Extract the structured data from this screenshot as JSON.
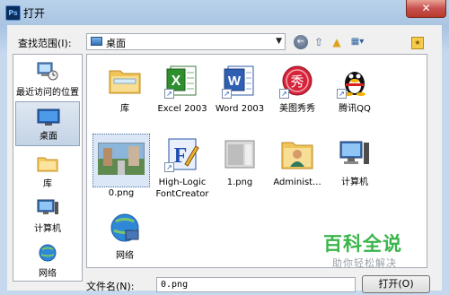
{
  "window": {
    "title": "打开",
    "app_icon": "Ps",
    "close_glyph": "✕"
  },
  "lookin": {
    "label": "查找范围(I):",
    "value": "桌面"
  },
  "toolbar": {
    "back": "←",
    "up": "⇧",
    "new_folder": "▲",
    "views": "▦▾",
    "extra": "★"
  },
  "places": [
    {
      "label": "最近访问的位置",
      "icon": "recent-places-icon"
    },
    {
      "label": "桌面",
      "icon": "desktop-icon",
      "selected": true
    },
    {
      "label": "库",
      "icon": "libraries-icon"
    },
    {
      "label": "计算机",
      "icon": "computer-icon"
    },
    {
      "label": "网络",
      "icon": "network-icon"
    }
  ],
  "files": [
    {
      "label": "库",
      "icon": "libraries-folder-icon"
    },
    {
      "label": "Excel 2003",
      "icon": "excel-icon",
      "shortcut": true
    },
    {
      "label": "Word 2003",
      "icon": "word-icon",
      "shortcut": true
    },
    {
      "label": "美图秀秀",
      "icon": "meitu-icon",
      "shortcut": true
    },
    {
      "label": "腾讯QQ",
      "icon": "qq-icon",
      "shortcut": true
    },
    {
      "label": "0.png",
      "icon": "image-thumbnail-icon",
      "selected": true
    },
    {
      "label": "High-Logic FontCreator",
      "icon": "fontcreator-icon",
      "shortcut": true
    },
    {
      "label": "1.png",
      "icon": "image-file-icon"
    },
    {
      "label": "Administ...",
      "icon": "user-folder-icon"
    },
    {
      "label": "计算机",
      "icon": "computer-icon"
    },
    {
      "label": "网络",
      "icon": "network-icon"
    }
  ],
  "filename": {
    "label": "文件名(N):",
    "value": "0.png"
  },
  "open_button": {
    "label": "打开(O)"
  },
  "watermark": {
    "brand": "百科全说",
    "tagline": "助你轻松解决"
  },
  "colors": {
    "accent": "#39b54a",
    "selection": "#dbe7f6"
  }
}
